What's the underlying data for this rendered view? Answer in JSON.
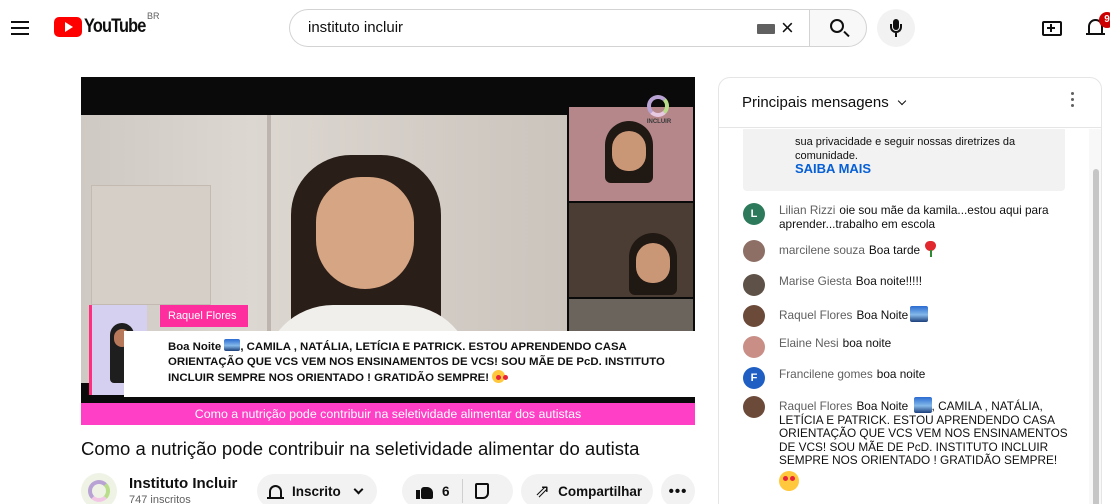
{
  "masthead": {
    "logo_text": "YouTube",
    "country": "BR",
    "search_value": "instituto incluir",
    "notification_count": "9"
  },
  "player": {
    "brand_label": "INCLUIR",
    "overlay_name": "Raquel Flores",
    "overlay_message_prefix": "Boa Noite",
    "overlay_message": ", CAMILA , NATÁLIA, LETÍCIA E PATRICK. ESTOU APRENDENDO CASA ORIENTAÇÃO QUE VCS VEM NOS ENSINAMENTOS DE VCS! SOU MÃE DE PcD. INSTITUTO INCLUIR SEMPRE NOS ORIENTADO ! GRATIDÃO SEMPRE!",
    "caption": "Como a nutrição pode contribuir na seletividade alimentar dos autistas"
  },
  "video": {
    "title": "Como a nutrição pode contribuir na seletividade alimentar do autista",
    "channel_name": "Instituto Incluir",
    "subscribers": "747 inscritos",
    "subscribe_label": "Inscrito",
    "like_count": "6",
    "share_label": "Compartilhar",
    "more_label": "•••"
  },
  "chat": {
    "mode_label": "Principais mensagens",
    "notice_text": "sua privacidade e seguir nossas diretrizes da comunidade.",
    "notice_link": "SAIBA MAIS",
    "messages": [
      {
        "author": "Lilian Rizzi",
        "text": "oie sou mãe da kamila...estou aqui para aprender...trabalho em escola",
        "initial": "L",
        "color": "#2c7a5b"
      },
      {
        "author": "marcilene souza",
        "text": "Boa tarde",
        "initial": "",
        "color": "#8d6f66"
      },
      {
        "author": "Marise Giesta",
        "text": "Boa noite!!!!!",
        "initial": "",
        "color": "#5e5147"
      },
      {
        "author": "Raquel Flores",
        "text": "Boa Noite",
        "initial": "",
        "color": "#6b4a3a"
      },
      {
        "author": "Elaine Nesi",
        "text": "boa noite",
        "initial": "",
        "color": "#c98f87"
      },
      {
        "author": "Francilene gomes",
        "text": "boa noite",
        "initial": "F",
        "color": "#1f5fc4"
      },
      {
        "author": "Raquel Flores",
        "text_prefix": "Boa Noite",
        "text": ", CAMILA , NATÁLIA, LETÍCIA E PATRICK. ESTOU APRENDENDO CASA ORIENTAÇÃO QUE VCS VEM NOS ENSINAMENTOS DE VCS! SOU MÃE DE PcD. INSTITUTO INCLUIR SEMPRE NOS ORIENTADO ! GRATIDÃO SEMPRE!",
        "initial": "",
        "color": "#6b4a3a"
      }
    ]
  },
  "colors": {
    "brand_red": "#ff0000",
    "overlay_pink": "#ff3fc5",
    "link_blue": "#065fd4"
  }
}
